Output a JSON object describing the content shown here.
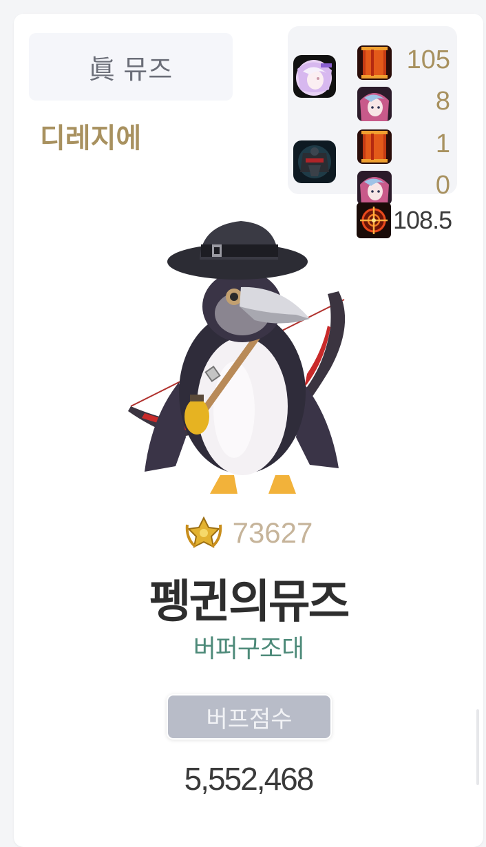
{
  "job": {
    "label": "眞 뮤즈"
  },
  "server": {
    "name": "디레지에"
  },
  "equipment": {
    "rows": [
      {
        "avatar_icon": "lilac-hair-avatar-icon",
        "slot_icon": "red-banner-icon",
        "value": "105"
      },
      {
        "avatar_icon": "",
        "slot_icon": "pink-hair-girl-icon",
        "value": "8"
      },
      {
        "avatar_icon": "dark-knight-avatar-icon",
        "slot_icon": "red-banner-icon",
        "value": "1"
      },
      {
        "avatar_icon": "",
        "slot_icon": "pink-hair-girl-icon",
        "value": "0"
      }
    ]
  },
  "crit": {
    "icon": "crosshair-icon",
    "value": "108.5"
  },
  "character": {
    "icon": "plague-doctor-penguin-icon"
  },
  "fame": {
    "icon": "gold-laurel-badge-icon",
    "value": "73627"
  },
  "name": "펭귄의뮤즈",
  "guild": "버퍼구조대",
  "buff": {
    "label": "버프점수",
    "score": "5,552,468"
  },
  "colors": {
    "accent_gold": "#a8915f",
    "guild_green": "#4d8a79",
    "fame_tan": "#c6b49a",
    "button_gray": "#b8bcc8"
  }
}
